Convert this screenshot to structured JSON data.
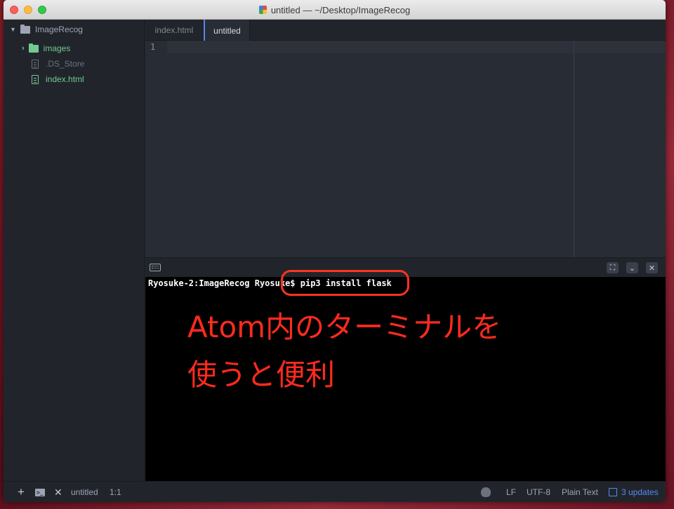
{
  "window": {
    "title": "untitled — ~/Desktop/ImageRecog"
  },
  "sidebar": {
    "project_name": "ImageRecog",
    "items": [
      {
        "label": "images",
        "type": "folder"
      },
      {
        "label": ".DS_Store",
        "type": "file"
      },
      {
        "label": "index.html",
        "type": "file"
      }
    ]
  },
  "tabs": [
    {
      "label": "index.html",
      "active": false
    },
    {
      "label": "untitled",
      "active": true
    }
  ],
  "editor": {
    "line_number": "1"
  },
  "terminal": {
    "prompt_line": "Ryosuke-2:ImageRecog Ryosuke$ pip3 install flask",
    "annotation_line1": "Atom内のターミナルを",
    "annotation_line2": "使うと便利"
  },
  "statusbar": {
    "plus": "+",
    "term_glyph": ">_",
    "close": "✕",
    "filename": "untitled",
    "cursor_position": "1:1",
    "line_ending": "LF",
    "encoding": "UTF-8",
    "grammar": "Plain Text",
    "updates": "3 updates"
  },
  "colors": {
    "accent": "#568af2",
    "git_added": "#73c991",
    "annotation": "#ff2a1e"
  },
  "icons": {
    "project": "folder-icon",
    "folder": "folder-icon",
    "file": "file-text-icon",
    "terminal_header": "keyboard-icon",
    "updates": "package-icon"
  }
}
